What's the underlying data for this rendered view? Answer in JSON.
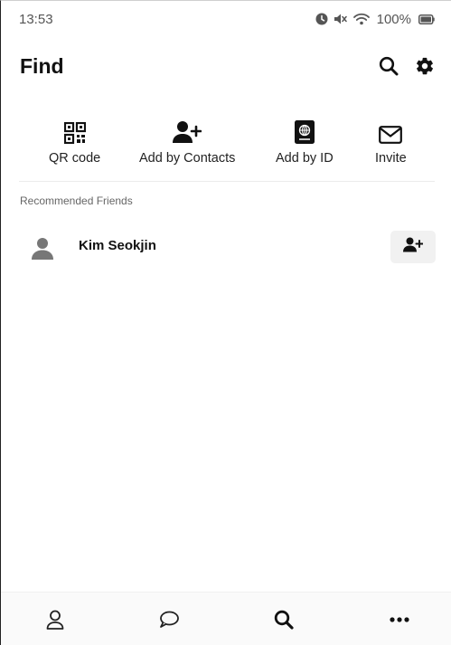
{
  "status_bar": {
    "time": "13:53",
    "battery": "100%",
    "icons": [
      "alarm-icon",
      "mute-icon",
      "wifi-icon",
      "battery-icon"
    ]
  },
  "header": {
    "title": "Find",
    "actions": [
      "search-icon",
      "gear-icon"
    ]
  },
  "quick_actions": [
    {
      "label": "QR code",
      "icon": "qr-code-icon"
    },
    {
      "label": "Add by Contacts",
      "icon": "add-contact-icon"
    },
    {
      "label": "Add by ID",
      "icon": "id-book-icon"
    },
    {
      "label": "Invite",
      "icon": "envelope-icon"
    }
  ],
  "recommended": {
    "section_label": "Recommended Friends",
    "friends": [
      {
        "name": "Kim Seokjin",
        "icon": "user-avatar-icon",
        "action_icon": "add-friend-icon"
      }
    ]
  },
  "bottom_nav": {
    "items": [
      "person-icon",
      "chat-bubble-icon",
      "search-icon",
      "more-icon"
    ],
    "active": "search-icon"
  },
  "colors": {
    "text": "#111111",
    "muted": "#666666",
    "status": "#555555",
    "avatar_gray": "#777777",
    "button_bg": "#f1f1f1"
  }
}
